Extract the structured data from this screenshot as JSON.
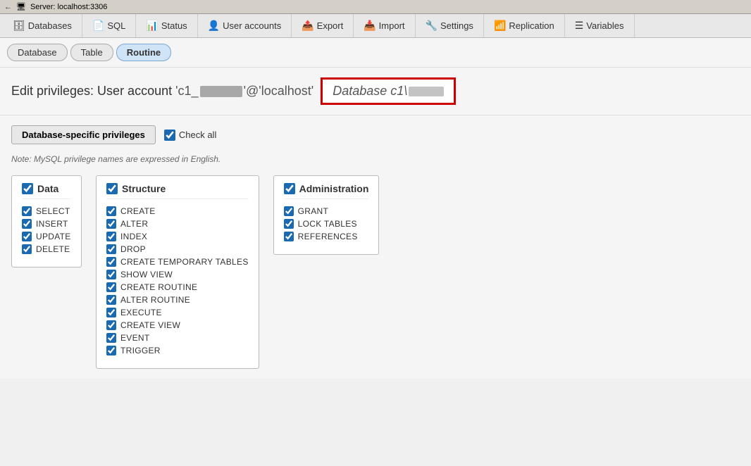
{
  "titlebar": {
    "back": "←",
    "server": "Server: localhost:3306",
    "icon": "🖥"
  },
  "nav": {
    "tabs": [
      {
        "id": "databases",
        "icon": "🗄",
        "label": "Databases"
      },
      {
        "id": "sql",
        "icon": "📄",
        "label": "SQL"
      },
      {
        "id": "status",
        "icon": "📊",
        "label": "Status"
      },
      {
        "id": "user-accounts",
        "icon": "👤",
        "label": "User accounts"
      },
      {
        "id": "export",
        "icon": "📤",
        "label": "Export"
      },
      {
        "id": "import",
        "icon": "📥",
        "label": "Import"
      },
      {
        "id": "settings",
        "icon": "🔧",
        "label": "Settings"
      },
      {
        "id": "replication",
        "icon": "📶",
        "label": "Replication"
      },
      {
        "id": "variables",
        "icon": "☰",
        "label": "Variables"
      }
    ]
  },
  "subtabs": [
    {
      "id": "database",
      "label": "Database"
    },
    {
      "id": "table",
      "label": "Table"
    },
    {
      "id": "routine",
      "label": "Routine",
      "active": true
    }
  ],
  "heading": {
    "prefix": "Edit privileges: User account ",
    "user": "'c1_███████'@'localhost'",
    "db_label": "Database c1\\███"
  },
  "toolbar": {
    "specific_label": "Database-specific privileges",
    "check_all_label": "Check all"
  },
  "note": "Note: MySQL privilege names are expressed in English.",
  "groups": [
    {
      "id": "data",
      "header": "Data",
      "items": [
        "SELECT",
        "INSERT",
        "UPDATE",
        "DELETE"
      ]
    },
    {
      "id": "structure",
      "header": "Structure",
      "items": [
        "CREATE",
        "ALTER",
        "INDEX",
        "DROP",
        "CREATE TEMPORARY TABLES",
        "SHOW VIEW",
        "CREATE ROUTINE",
        "ALTER ROUTINE",
        "EXECUTE",
        "CREATE VIEW",
        "EVENT",
        "TRIGGER"
      ]
    },
    {
      "id": "administration",
      "header": "Administration",
      "items": [
        "GRANT",
        "LOCK TABLES",
        "REFERENCES"
      ]
    }
  ]
}
